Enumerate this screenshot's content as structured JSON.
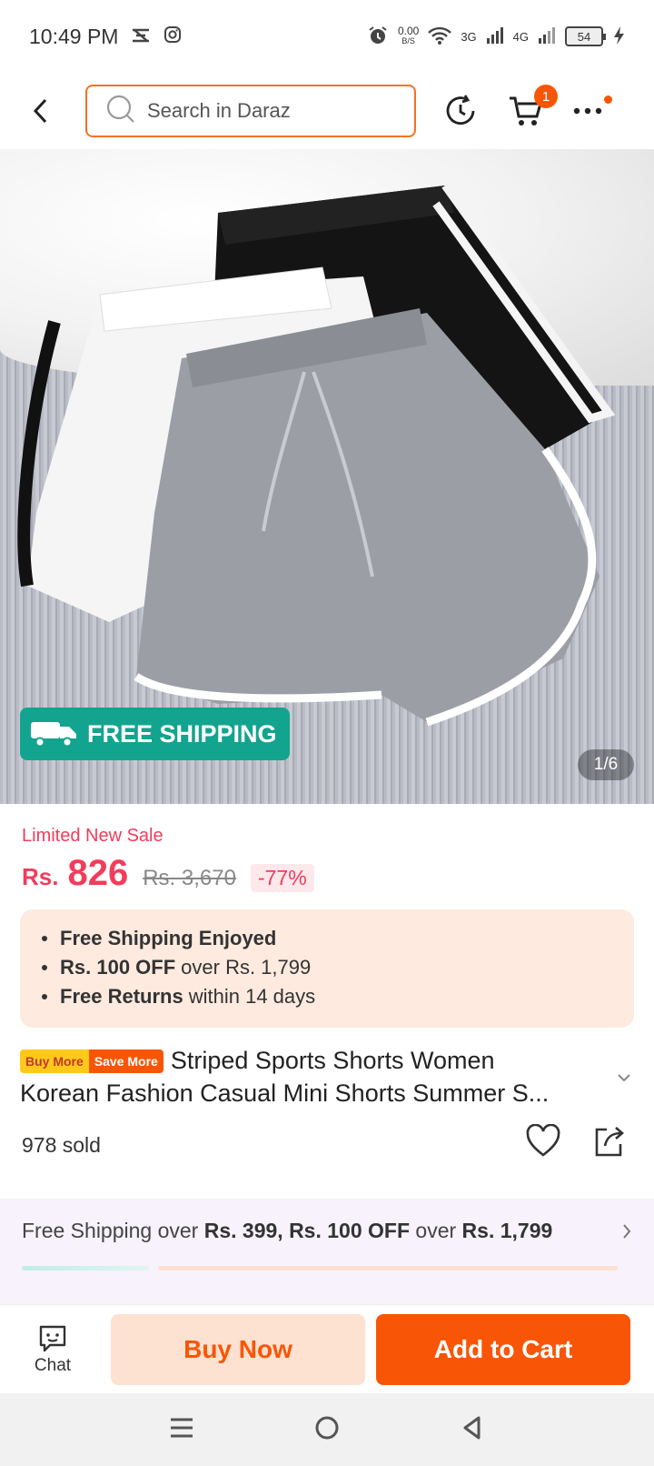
{
  "status_bar": {
    "time": "10:49 PM",
    "net_speed": "0.00",
    "net_unit": "B/S",
    "sig1": "3G",
    "sig2": "4G",
    "battery": "54"
  },
  "header": {
    "search_placeholder": "Search in Daraz",
    "cart_count": "1"
  },
  "image": {
    "badge_text": "FREE SHIPPING",
    "badge_mini": "FREE",
    "counter": "1/6"
  },
  "price": {
    "sale_label": "Limited New Sale",
    "currency": "Rs.",
    "current": "826",
    "original": "Rs. 3,670",
    "discount": "-77%"
  },
  "benefits": [
    {
      "bold": "Free Shipping Enjoyed",
      "rest": ""
    },
    {
      "bold": "Rs. 100 OFF",
      "rest": "over Rs. 1,799"
    },
    {
      "bold": "Free Returns",
      "rest": "within 14 days"
    }
  ],
  "product": {
    "tag_a": "Buy More",
    "tag_b": "Save More",
    "title_line1": "Striped Sports Shorts Women",
    "title_line2": "Korean Fashion Casual Mini Shorts Summer S...",
    "sold": "978 sold"
  },
  "shipping_banner": {
    "t1": "Free Shipping over ",
    "b1": "Rs. 399, Rs. 100 OFF",
    "t2": " over ",
    "b2": "Rs. 1,799"
  },
  "actions": {
    "chat": "Chat",
    "buy_now": "Buy Now",
    "add_to_cart": "Add to Cart"
  },
  "colors": {
    "accent": "#f85606",
    "price": "#f23c5b",
    "shipping_badge": "#12a48e"
  }
}
